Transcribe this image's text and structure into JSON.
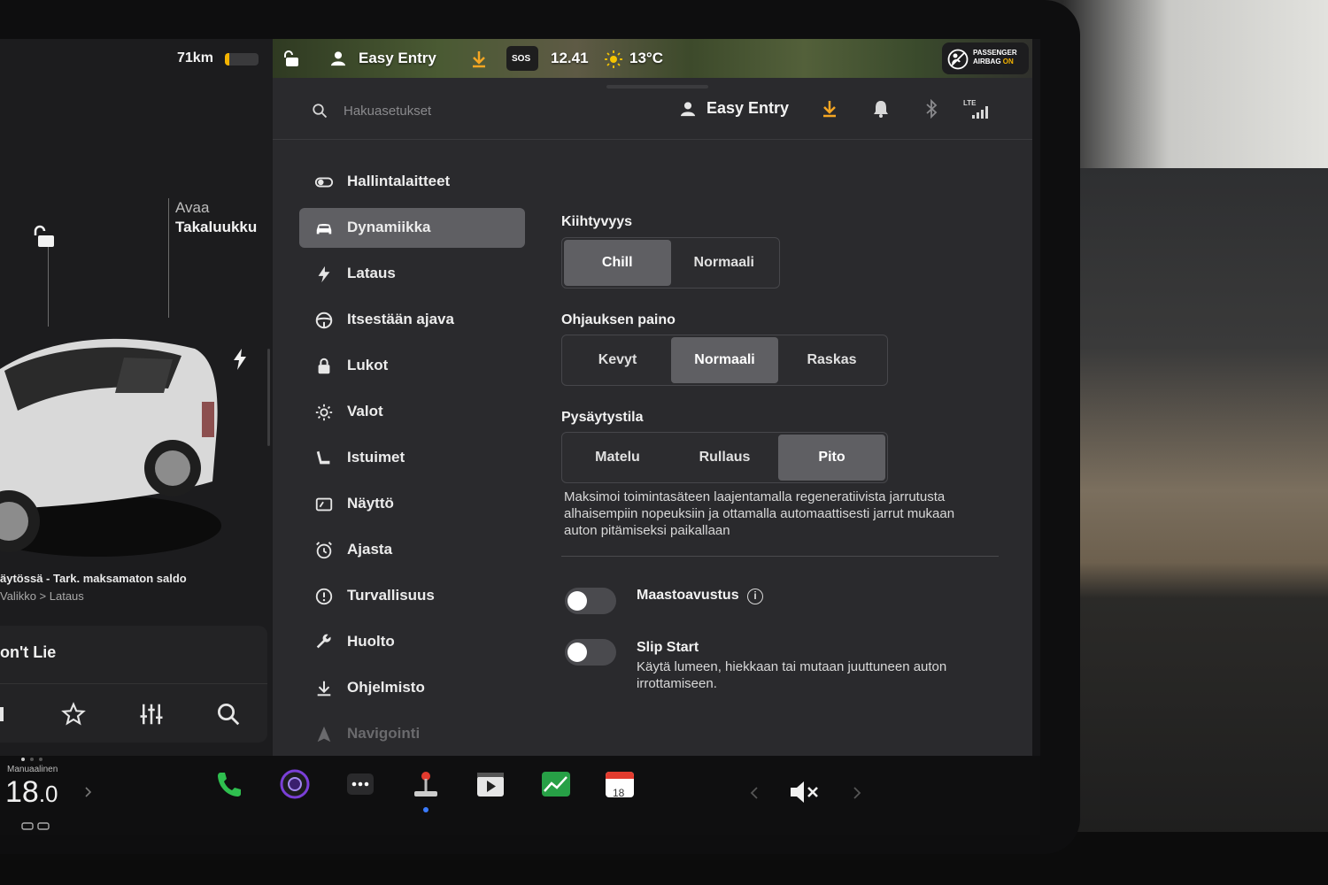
{
  "left_pane": {
    "range": "71km",
    "battery_level": 0.12,
    "trunk_label_top": "Avaa",
    "trunk_label_bottom": "Takaluukku",
    "charge_message": "äytössä - Tark. maksamaton saldo",
    "charge_sub": "Valikko > Lataus",
    "media_title": "on't Lie"
  },
  "status_bar": {
    "profile": "Easy Entry",
    "sos": "SOS",
    "time": "12.41",
    "temperature": "13°C",
    "airbag_line1": "PASSENGER",
    "airbag_line2_prefix": "AIRBAG",
    "airbag_line2_status": "ON"
  },
  "top_bar": {
    "search_placeholder": "Hakuasetukset",
    "profile": "Easy Entry",
    "lte_label": "LTE"
  },
  "sidebar": {
    "items": [
      {
        "label": "Hallintalaitteet",
        "icon": "toggle-icon"
      },
      {
        "label": "Dynamiikka",
        "icon": "car-icon",
        "active": true
      },
      {
        "label": "Lataus",
        "icon": "bolt-icon"
      },
      {
        "label": "Itsestään ajava",
        "icon": "steering-wheel-icon"
      },
      {
        "label": "Lukot",
        "icon": "lock-icon"
      },
      {
        "label": "Valot",
        "icon": "light-icon"
      },
      {
        "label": "Istuimet",
        "icon": "seat-icon"
      },
      {
        "label": "Näyttö",
        "icon": "display-icon"
      },
      {
        "label": "Ajasta",
        "icon": "alarm-clock-icon"
      },
      {
        "label": "Turvallisuus",
        "icon": "info-circle-icon"
      },
      {
        "label": "Huolto",
        "icon": "wrench-icon"
      },
      {
        "label": "Ohjelmisto",
        "icon": "download-icon"
      },
      {
        "label": "Navigointi",
        "icon": "navigation-icon"
      }
    ]
  },
  "dynamics": {
    "acceleration": {
      "title": "Kiihtyvyys",
      "options": [
        "Chill",
        "Normaali"
      ],
      "selected": "Chill"
    },
    "steering": {
      "title": "Ohjauksen paino",
      "options": [
        "Kevyt",
        "Normaali",
        "Raskas"
      ],
      "selected": "Normaali"
    },
    "stopping": {
      "title": "Pysäytystila",
      "options": [
        "Matelu",
        "Rullaus",
        "Pito"
      ],
      "selected": "Pito",
      "description": "Maksimoi toimintasäteen laajentamalla regeneratiivista jarrutusta alhaisempiin nopeuksiin ja ottamalla automaattisesti jarrut mukaan auton pitämiseksi paikallaan"
    },
    "terrain_assist": {
      "label": "Maastoavustus",
      "enabled": false
    },
    "slip_start": {
      "label": "Slip Start",
      "enabled": false,
      "description": "Käytä lumeen, hiekkaan tai mutaan juuttuneen auton irrottamiseen."
    }
  },
  "dock": {
    "climate_label": "Manuaalinen",
    "temp_int": "18",
    "temp_dec": ".0",
    "calendar_day": "18",
    "colors": {
      "phone": "#2fbf4f",
      "camera": "#7a3fd6",
      "toybox": "#e23b2e",
      "stocks": "#27a046",
      "calendar": "#e23b2e"
    }
  },
  "colors": {
    "accent_download": "#f5a623",
    "selected_segment": "#5f5f63",
    "panel_bg": "#2a2a2d"
  }
}
